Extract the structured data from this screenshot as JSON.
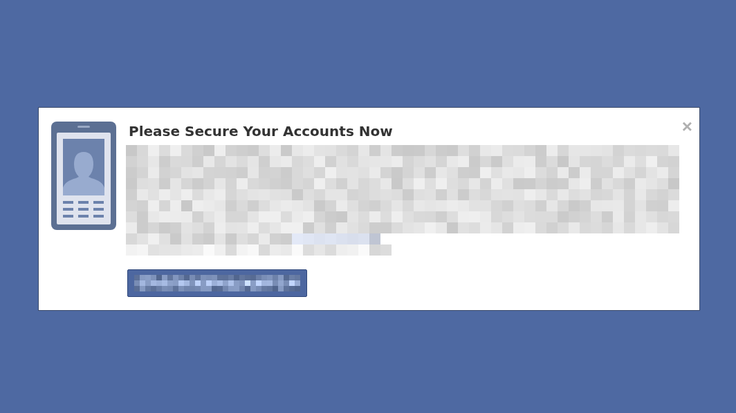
{
  "dialog": {
    "title": "Please Secure Your Accounts Now",
    "close_label": "×"
  }
}
